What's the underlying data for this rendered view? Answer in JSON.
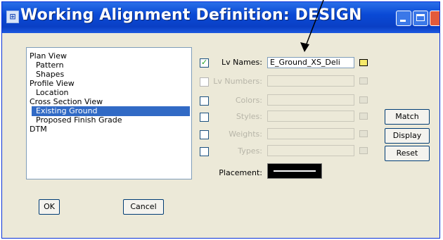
{
  "window": {
    "title": "Working Alignment Definition: DESIGN"
  },
  "tree": {
    "items": [
      {
        "label": "Plan View",
        "level": 0,
        "selected": false
      },
      {
        "label": "Pattern",
        "level": 1,
        "selected": false
      },
      {
        "label": "Shapes",
        "level": 1,
        "selected": false
      },
      {
        "label": "Profile View",
        "level": 0,
        "selected": false
      },
      {
        "label": "Location",
        "level": 1,
        "selected": false
      },
      {
        "label": "Cross Section View",
        "level": 0,
        "selected": false
      },
      {
        "label": "Existing Ground",
        "level": 1,
        "selected": true
      },
      {
        "label": "Proposed Finish Grade",
        "level": 1,
        "selected": false
      },
      {
        "label": "DTM",
        "level": 0,
        "selected": false
      }
    ]
  },
  "symbology": {
    "rows": [
      {
        "label": "Lv Names:",
        "value": "E_Ground_XS_Deli",
        "checked": true,
        "enabled": true
      },
      {
        "label": "Lv Numbers:",
        "value": "",
        "checked": false,
        "enabled": false
      },
      {
        "label": "Colors:",
        "value": "",
        "checked": false,
        "enabled": false
      },
      {
        "label": "Styles:",
        "value": "",
        "checked": false,
        "enabled": false
      },
      {
        "label": "Weights:",
        "value": "",
        "checked": false,
        "enabled": false
      },
      {
        "label": "Types:",
        "value": "",
        "checked": false,
        "enabled": false
      }
    ],
    "placement_label": "Placement:"
  },
  "buttons": {
    "match": "Match",
    "display": "Display",
    "reset": "Reset",
    "ok": "OK",
    "cancel": "Cancel"
  },
  "colors": {
    "titlebar": "#0a4ad6",
    "selection": "#316ac5",
    "dialog_bg": "#ece9d8"
  }
}
